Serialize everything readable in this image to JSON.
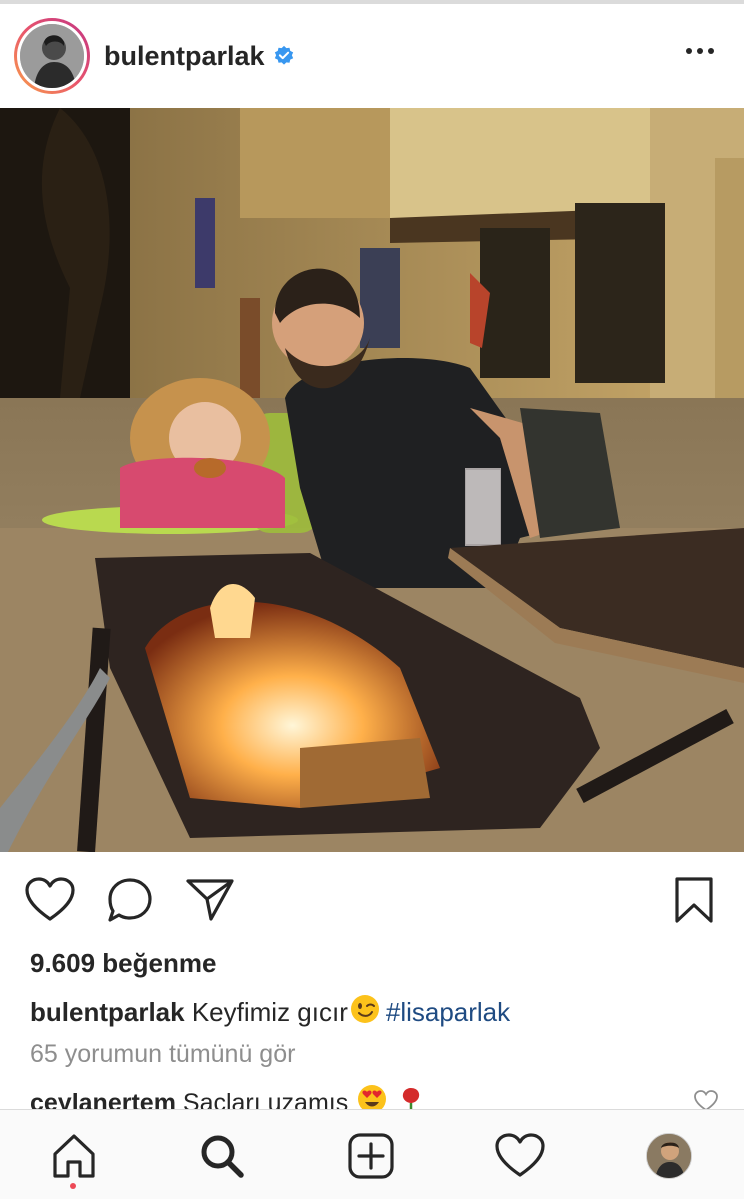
{
  "post": {
    "username": "bulentparlak",
    "verified": true,
    "photo_subject": "man-and-child-by-fire-pit"
  },
  "stats": {
    "likes_text": "9.609 beğenme"
  },
  "caption": {
    "username": "bulentparlak",
    "text": "Keyfimiz gıcır",
    "emoji": "winking-face",
    "hashtag": "#lisaparlak"
  },
  "comments_link": "65 yorumun tümünü gör",
  "top_comment": {
    "username": "ceylanertem",
    "text": "Saçları uzamış",
    "emojis": [
      "heart-eyes",
      "rose"
    ]
  },
  "icons": {
    "like": "heart-outline-icon",
    "comment": "comment-bubble-icon",
    "share": "paper-plane-icon",
    "save": "bookmark-icon"
  },
  "tabs": [
    "home",
    "search",
    "new-post",
    "activity",
    "profile"
  ],
  "colors": {
    "text": "#262626",
    "muted": "#8e8e8e",
    "hashtag": "#1f4b82",
    "verified": "#3897f0",
    "notification_dot": "#ed4956"
  }
}
